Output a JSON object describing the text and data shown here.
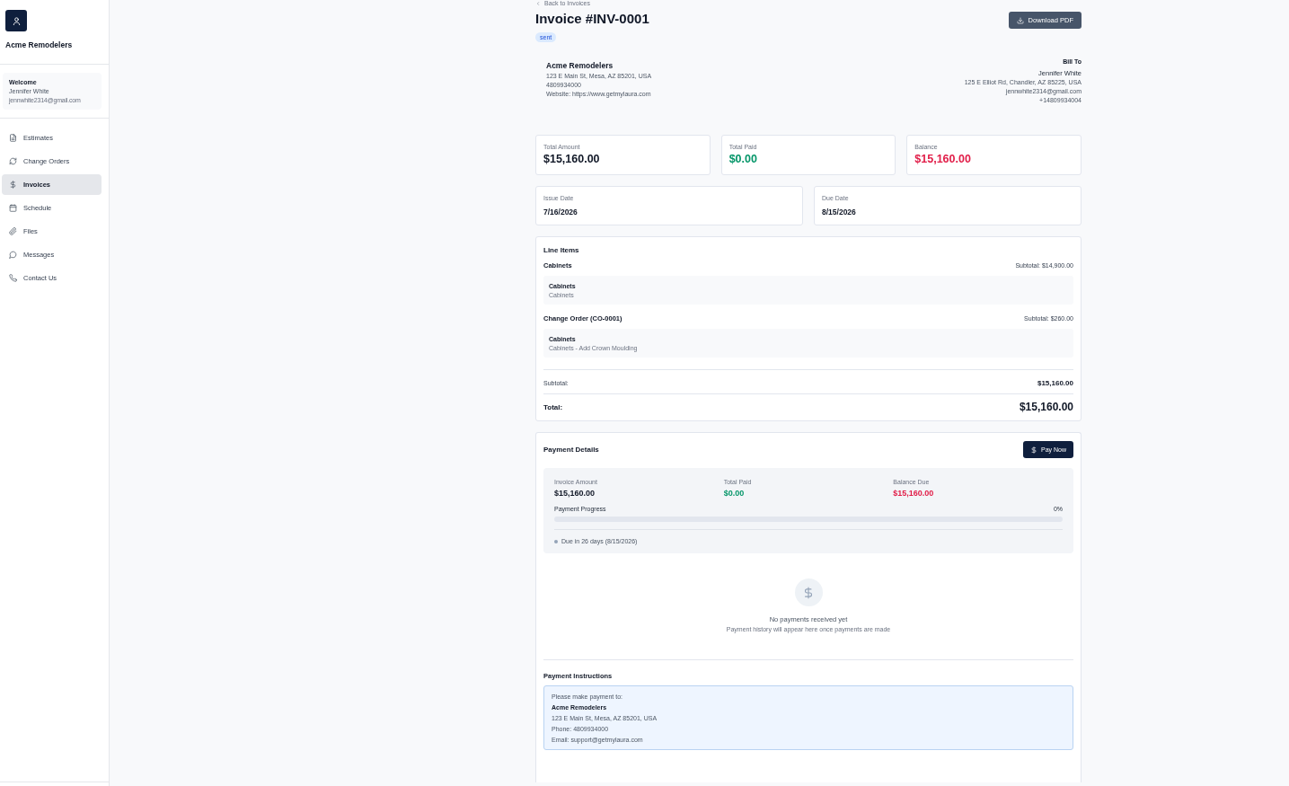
{
  "sidebar": {
    "company": "Acme Remodelers",
    "welcome": {
      "title": "Welcome",
      "name": "Jennifer White",
      "email": "jennwhite2314@gmail.com"
    },
    "items": [
      {
        "label": "Estimates",
        "selected": false
      },
      {
        "label": "Change Orders",
        "selected": false
      },
      {
        "label": "Invoices",
        "selected": true
      },
      {
        "label": "Schedule",
        "selected": false
      },
      {
        "label": "Files",
        "selected": false
      },
      {
        "label": "Messages",
        "selected": false
      },
      {
        "label": "Contact Us",
        "selected": false
      }
    ]
  },
  "header": {
    "back_link": "Back to Invoices",
    "title": "Invoice #INV-0001",
    "status": "sent",
    "download_button": "Download PDF"
  },
  "from": {
    "name": "Acme Remodelers",
    "address": "123 E Main St, Mesa, AZ 85201, USA",
    "phone": "4809934000",
    "website": "Website: https://www.getmylaura.com"
  },
  "bill_to": {
    "heading": "Bill To",
    "name": "Jennifer White",
    "address": "125 E Elliot Rd, Chandler, AZ 85225, USA",
    "email": "jennwhite2314@gmail.com",
    "phone": "+14809934004"
  },
  "summary": [
    {
      "label": "Total Amount",
      "value": "$15,160.00",
      "kind": "neutral"
    },
    {
      "label": "Total Paid",
      "value": "$0.00",
      "kind": "paid"
    },
    {
      "label": "Balance",
      "value": "$15,160.00",
      "kind": "due"
    }
  ],
  "dates": [
    {
      "label": "Issue Date",
      "value": "7/16/2026"
    },
    {
      "label": "Due Date",
      "value": "8/15/2026"
    }
  ],
  "line_items": {
    "title": "Line Items",
    "groups": [
      {
        "name": "Cabinets",
        "subtotal": "Subtotal: $14,900.00",
        "items": [
          {
            "name": "Cabinets",
            "description": "Cabinets"
          }
        ]
      },
      {
        "name": "Change Order (CO-0001)",
        "subtotal": "Subtotal: $260.00",
        "items": [
          {
            "name": "Cabinets",
            "description": "Cabinets - Add Crown Moulding"
          }
        ]
      }
    ],
    "subtotal_label": "Subtotal:",
    "subtotal": "$15,160.00",
    "total_label": "Total:",
    "total": "$15,160.00"
  },
  "payment": {
    "title": "Payment Details",
    "pay_button": "Pay Now",
    "amounts": [
      {
        "label": "Invoice Amount",
        "value": "$15,160.00",
        "kind": "neutral"
      },
      {
        "label": "Total Paid",
        "value": "$0.00",
        "kind": "paid"
      },
      {
        "label": "Balance Due",
        "value": "$15,160.00",
        "kind": "due"
      }
    ],
    "progress_label": "Payment Progress",
    "progress_reading": "0%",
    "level": 0,
    "due_note": "Due in 26 days (8/15/2026)",
    "empty_title": "No payments received yet",
    "empty_text": "Payment history will appear here once payments are made",
    "instructions_title": "Payment Instructions",
    "instructions": {
      "intro": "Please make payment to:",
      "name": "Acme Remodelers",
      "address": "123 E Main St, Mesa, AZ 85201, USA",
      "phone": "Phone: 4809934000",
      "email": "Email: support@getmylaura.com"
    }
  }
}
